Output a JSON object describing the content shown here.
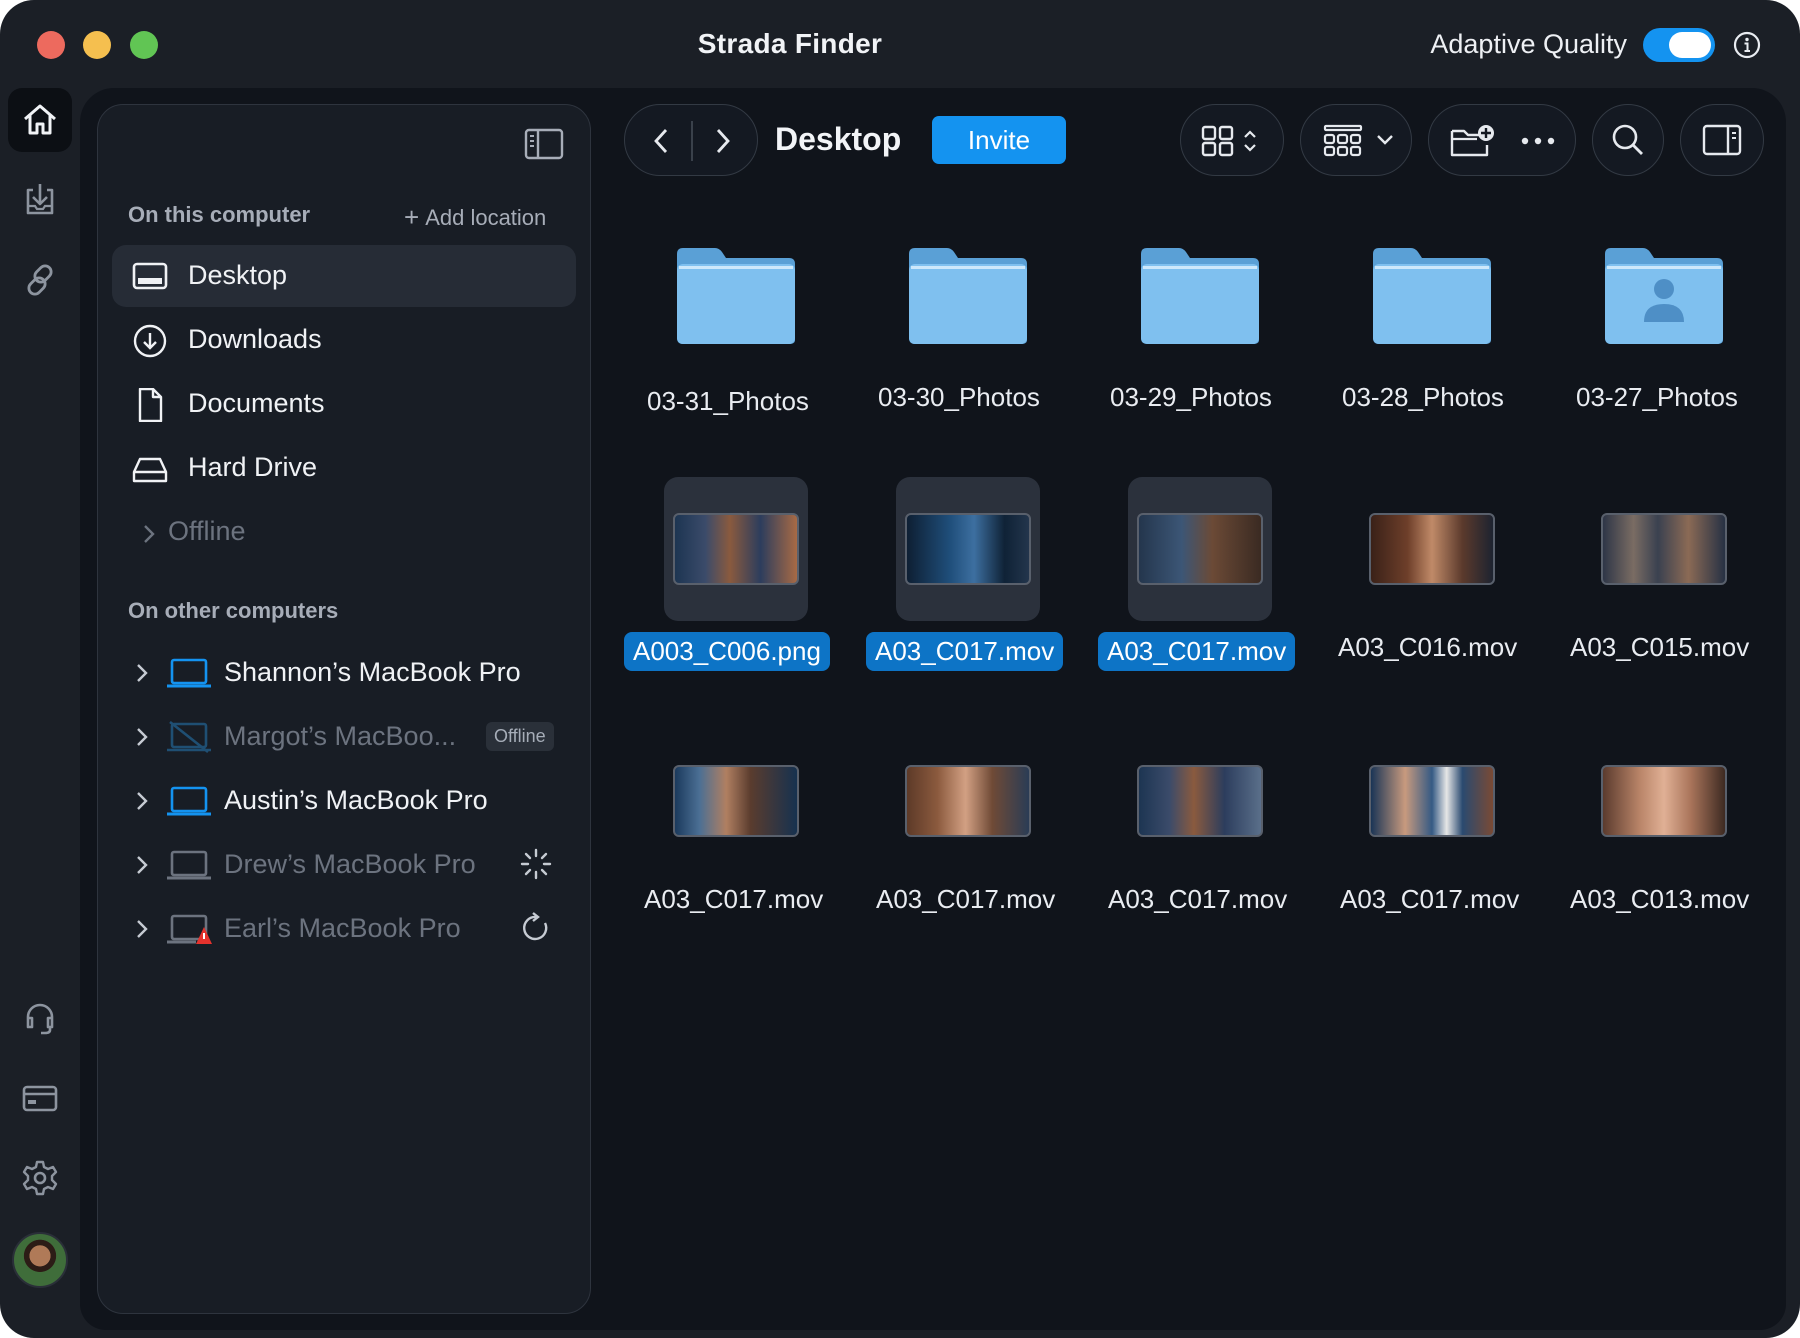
{
  "titlebar": {
    "app_title": "Strada Finder",
    "adaptive_quality_label": "Adaptive Quality",
    "adaptive_quality_on": true,
    "accent_color": "#1493f0"
  },
  "rail": {
    "top_icons": [
      "home-icon",
      "download-tray-icon",
      "link-icon"
    ],
    "bottom_icons": [
      "headset-icon",
      "card-icon",
      "gear-icon"
    ]
  },
  "sidebar": {
    "this_computer_header": "On this computer",
    "add_location_label": "Add location",
    "locations": [
      {
        "label": "Desktop",
        "icon": "desktop-icon",
        "selected": true
      },
      {
        "label": "Downloads",
        "icon": "download-circle-icon"
      },
      {
        "label": "Documents",
        "icon": "document-icon"
      },
      {
        "label": "Hard Drive",
        "icon": "hard-drive-icon"
      },
      {
        "label": "Offline",
        "icon": "chevron-right-icon"
      }
    ],
    "other_computers_header": "On other computers",
    "computers": [
      {
        "label": "Shannon’s MacBook Pro",
        "status": "online"
      },
      {
        "label": "Margot’s MacBoo...",
        "status": "offline",
        "badge": "Offline"
      },
      {
        "label": "Austin’s MacBook Pro",
        "status": "online"
      },
      {
        "label": "Drew’s MacBook Pro",
        "status": "loading"
      },
      {
        "label": "Earl’s MacBook Pro",
        "status": "error"
      }
    ]
  },
  "toolbar": {
    "location_title": "Desktop",
    "invite_label": "Invite"
  },
  "files": {
    "row1": [
      "03-31_Photos",
      "03-30_Photos",
      "03-29_Photos",
      "03-28_Photos",
      "03-27_Photos"
    ],
    "row2": [
      "A003_C006.png",
      "A03_C017.mov",
      "A03_C017.mov",
      "A03_C016.mov",
      "A03_C015.mov"
    ],
    "row3": [
      "A03_C017.mov",
      "A03_C017.mov",
      "A03_C017.mov",
      "A03_C017.mov",
      "A03_C013.mov"
    ]
  }
}
